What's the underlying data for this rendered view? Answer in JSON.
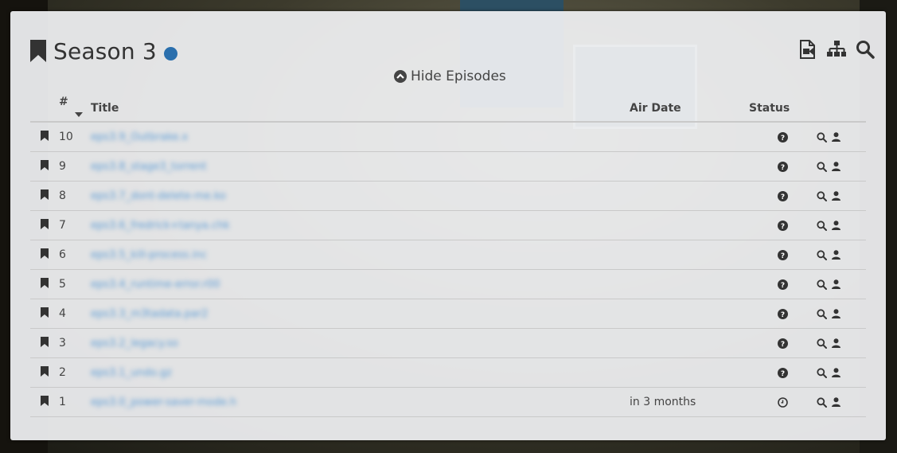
{
  "season": {
    "title": "Season 3",
    "dot_color": "#2a6fad"
  },
  "toolbar": {
    "icons": [
      "video-file-icon",
      "sitemap-icon",
      "search-icon"
    ]
  },
  "toggle": {
    "label": "Hide Episodes"
  },
  "table": {
    "headers": {
      "number": "#",
      "title": "Title",
      "air_date": "Air Date",
      "status": "Status"
    },
    "rows": [
      {
        "number": "10",
        "title": "eps3.9_Outbrake.x",
        "air_date": "",
        "status_icon": "question-circle-icon"
      },
      {
        "number": "9",
        "title": "eps3.8_stage3_torrent",
        "air_date": "",
        "status_icon": "question-circle-icon"
      },
      {
        "number": "8",
        "title": "eps3.7_dont-delete-me.ko",
        "air_date": "",
        "status_icon": "question-circle-icon"
      },
      {
        "number": "7",
        "title": "eps3.6_fredrick+tanya.chk",
        "air_date": "",
        "status_icon": "question-circle-icon"
      },
      {
        "number": "6",
        "title": "eps3.5_kill-process.inc",
        "air_date": "",
        "status_icon": "question-circle-icon"
      },
      {
        "number": "5",
        "title": "eps3.4_runtime-error.r00",
        "air_date": "",
        "status_icon": "question-circle-icon"
      },
      {
        "number": "4",
        "title": "eps3.3_m3tadata.par2",
        "air_date": "",
        "status_icon": "question-circle-icon"
      },
      {
        "number": "3",
        "title": "eps3.2_legacy.so",
        "air_date": "",
        "status_icon": "question-circle-icon"
      },
      {
        "number": "2",
        "title": "eps3.1_undo.gz",
        "air_date": "",
        "status_icon": "question-circle-icon"
      },
      {
        "number": "1",
        "title": "eps3.0_power-saver-mode.h",
        "air_date": "in 3 months",
        "status_icon": "clock-icon"
      }
    ]
  }
}
